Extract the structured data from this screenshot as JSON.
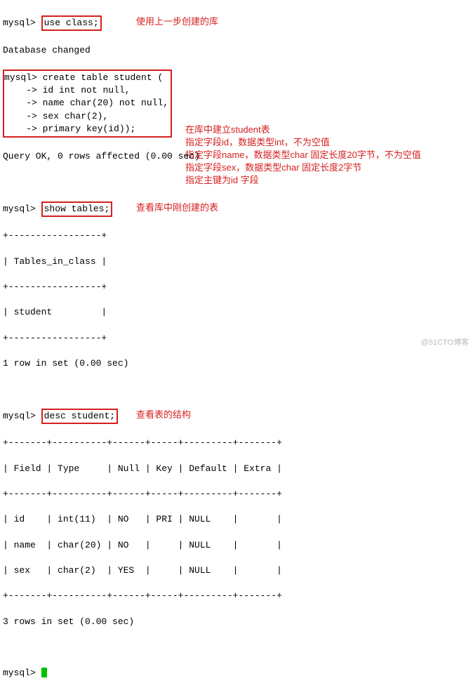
{
  "prompt": "mysql>",
  "cont": "    ->",
  "cmd1": "use class;",
  "ann1": "使用上一步创建的库",
  "dbchanged": "Database changed",
  "cmd2_1": "create table student (",
  "cmd2_2": "id int not null,",
  "cmd2_3": "name char(20) not null,",
  "cmd2_4": "sex char(2),",
  "cmd2_5": "primary key(id));",
  "ann2a": "在库中建立student表",
  "ann2b": "指定字段id，数据类型int，不为空值",
  "ann2c": "指定字段name，数据类型char 固定长度20字节，不为空值",
  "ann2d": "指定字段sex，数据类型char 固定长度2字节",
  "ann2e": "指定主键为id 字段",
  "queryok": "Query OK, 0 rows affected (0.00 sec)",
  "cmd3": "show tables;",
  "ann3": "查看库中刚创建的表",
  "tbl_sep": "+-----------------+",
  "tbl_hdr": "| Tables_in_class |",
  "tbl_row": "| student         |",
  "rows1": "1 row in set (0.00 sec)",
  "cmd4": "desc student;",
  "ann4": "查看表的结构",
  "desc_sep": "+-------+----------+------+-----+---------+-------+",
  "desc_hdr": "| Field | Type     | Null | Key | Default | Extra |",
  "desc_r1": "| id    | int(11)  | NO   | PRI | NULL    |       |",
  "desc_r2": "| name  | char(20) | NO   |     | NULL    |       |",
  "desc_r3": "| sex   | char(2)  | YES  |     | NULL    |       |",
  "rows3": "3 rows in set (0.00 sec)",
  "watermark": "@51CTO博客"
}
